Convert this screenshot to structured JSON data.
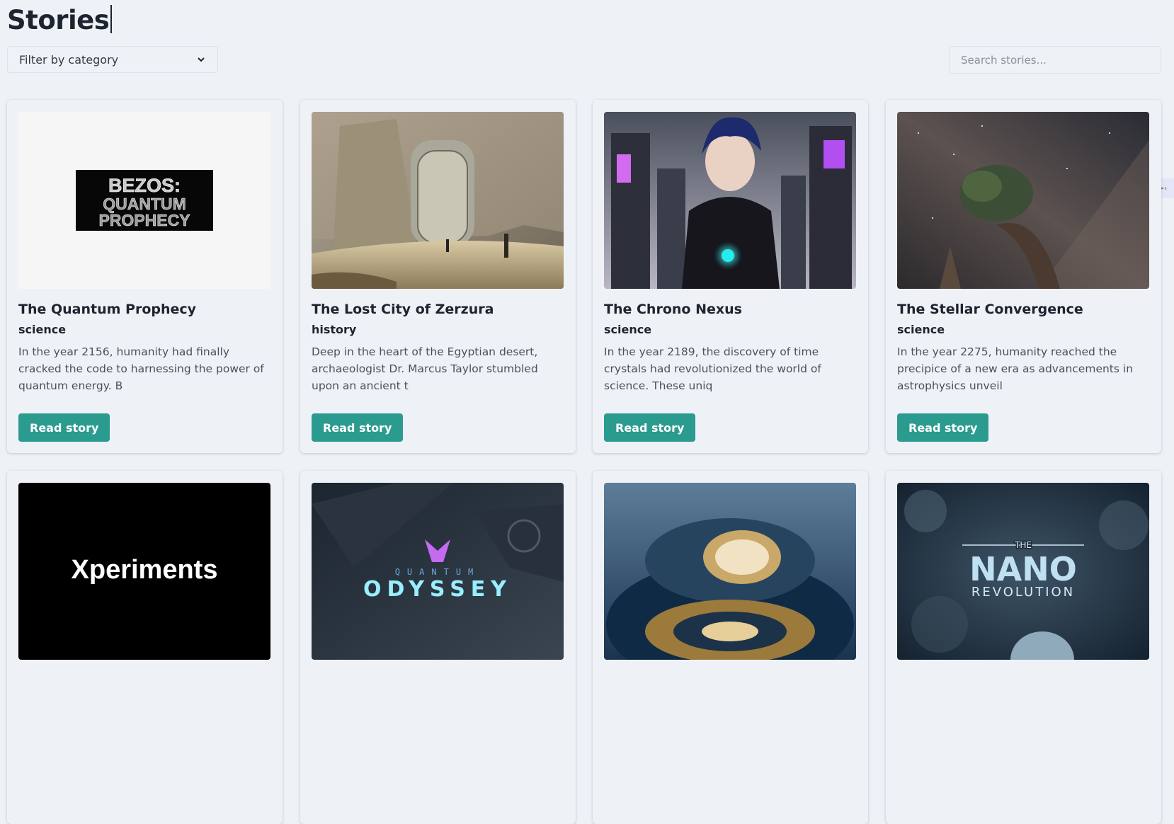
{
  "header": {
    "title": "Stories"
  },
  "filter": {
    "label": "Filter by category"
  },
  "search": {
    "placeholder": "Search stories..."
  },
  "side_tab": {
    "label": ">‹"
  },
  "stories": [
    {
      "title": "The Quantum Prophecy",
      "category": "science",
      "excerpt": "In the year 2156, humanity had finally cracked the code to harnessing the power of quantum energy. B",
      "button": "Read story",
      "image_text": [
        "BEZOS:",
        "QUANTUM",
        "PROPHECY"
      ]
    },
    {
      "title": "The Lost City of Zerzura",
      "category": "history",
      "excerpt": "Deep in the heart of the Egyptian desert, archaeologist Dr. Marcus Taylor stumbled upon an ancient t",
      "button": "Read story"
    },
    {
      "title": "The Chrono Nexus",
      "category": "science",
      "excerpt": "In the year 2189, the discovery of time crystals had revolutionized the world of science. These uniq",
      "button": "Read story"
    },
    {
      "title": "The Stellar Convergence",
      "category": "science",
      "excerpt": "In the year 2275, humanity reached the precipice of a new era as advancements in astrophysics unveil",
      "button": "Read story"
    },
    {
      "image_text": [
        "Xperiments"
      ]
    },
    {
      "image_text": [
        "QUANTUM",
        "ODYSSEY"
      ]
    },
    {},
    {
      "image_text": [
        "THE",
        "NANO",
        "REVOLUTION"
      ]
    }
  ],
  "colors": {
    "accent": "#2b9b8f",
    "background": "#eef2f7"
  }
}
